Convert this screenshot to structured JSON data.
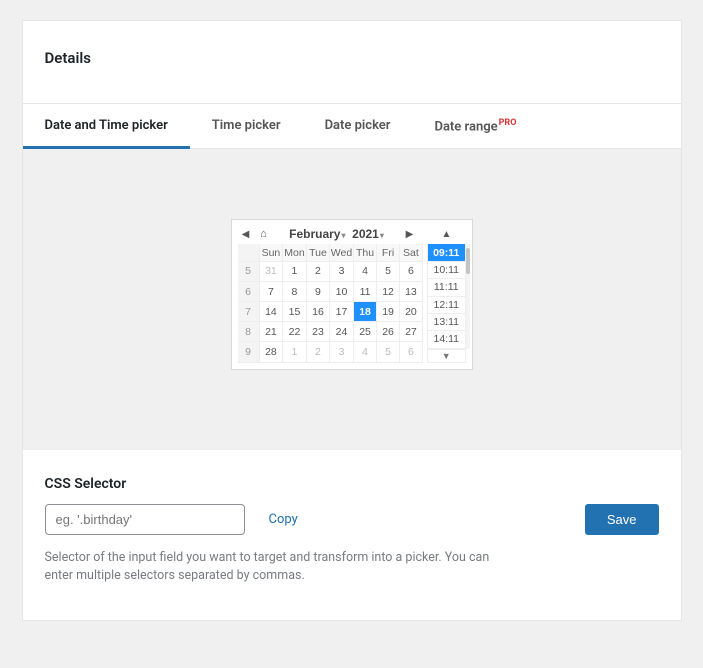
{
  "header": {
    "title": "Details"
  },
  "tabs": [
    {
      "label": "Date and Time picker",
      "active": true
    },
    {
      "label": "Time picker"
    },
    {
      "label": "Date picker"
    },
    {
      "label": "Date range",
      "badge": "PRO"
    }
  ],
  "calendar": {
    "month": "February",
    "year": "2021",
    "day_headers": [
      "Sun",
      "Mon",
      "Tue",
      "Wed",
      "Thu",
      "Fri",
      "Sat"
    ],
    "weeks": [
      {
        "wk": "5",
        "days": [
          {
            "d": "31",
            "other": true
          },
          {
            "d": "1"
          },
          {
            "d": "2"
          },
          {
            "d": "3"
          },
          {
            "d": "4"
          },
          {
            "d": "5"
          },
          {
            "d": "6"
          }
        ]
      },
      {
        "wk": "6",
        "days": [
          {
            "d": "7"
          },
          {
            "d": "8"
          },
          {
            "d": "9"
          },
          {
            "d": "10"
          },
          {
            "d": "11"
          },
          {
            "d": "12"
          },
          {
            "d": "13"
          }
        ]
      },
      {
        "wk": "7",
        "days": [
          {
            "d": "14"
          },
          {
            "d": "15"
          },
          {
            "d": "16"
          },
          {
            "d": "17"
          },
          {
            "d": "18",
            "sel": true
          },
          {
            "d": "19"
          },
          {
            "d": "20"
          }
        ]
      },
      {
        "wk": "8",
        "days": [
          {
            "d": "21"
          },
          {
            "d": "22"
          },
          {
            "d": "23"
          },
          {
            "d": "24"
          },
          {
            "d": "25"
          },
          {
            "d": "26"
          },
          {
            "d": "27"
          }
        ]
      },
      {
        "wk": "9",
        "days": [
          {
            "d": "28"
          },
          {
            "d": "1",
            "other": true
          },
          {
            "d": "2",
            "other": true
          },
          {
            "d": "3",
            "other": true
          },
          {
            "d": "4",
            "other": true
          },
          {
            "d": "5",
            "other": true
          },
          {
            "d": "6",
            "other": true
          }
        ]
      }
    ],
    "times": [
      {
        "t": "09:11",
        "sel": true
      },
      {
        "t": "10:11"
      },
      {
        "t": "11:11"
      },
      {
        "t": "12:11"
      },
      {
        "t": "13:11"
      },
      {
        "t": "14:11"
      }
    ]
  },
  "selector_section": {
    "label": "CSS Selector",
    "placeholder": "eg. '.birthday'",
    "copy": "Copy",
    "save": "Save",
    "help": "Selector of the input field you want to target and transform into a picker. You can enter multiple selectors separated by commas."
  }
}
